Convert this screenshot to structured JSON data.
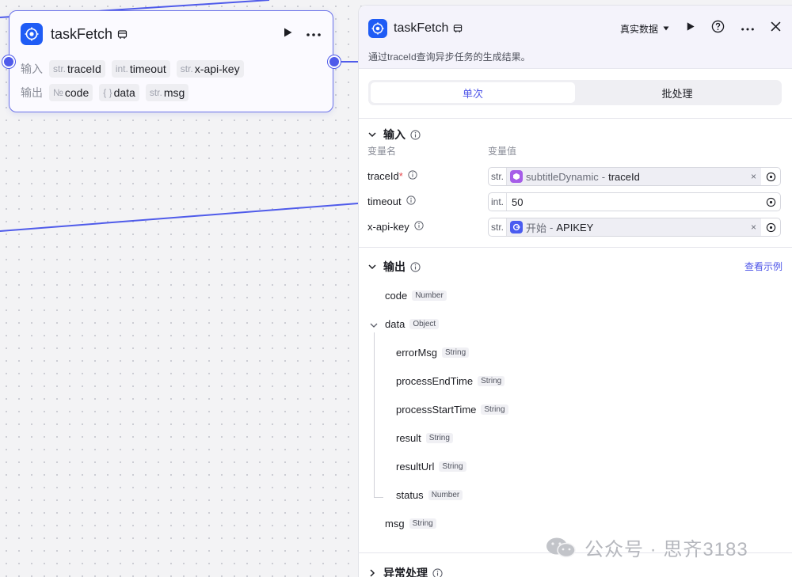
{
  "node": {
    "title": "taskFetch",
    "input_label": "输入",
    "output_label": "输出",
    "inputs": [
      {
        "type": "str.",
        "name": "traceId"
      },
      {
        "type": "int.",
        "name": "timeout"
      },
      {
        "type": "str.",
        "name": "x-api-key"
      }
    ],
    "outputs": [
      {
        "type": "№",
        "name": "code"
      },
      {
        "type": "{ }",
        "name": "data"
      },
      {
        "type": "str.",
        "name": "msg"
      }
    ]
  },
  "panel": {
    "title": "taskFetch",
    "data_mode": "真实数据",
    "description": "通过traceId查询异步任务的生成结果。",
    "tabs": [
      {
        "label": "单次",
        "active": true
      },
      {
        "label": "批处理",
        "active": false
      }
    ],
    "input_section": {
      "title": "输入",
      "col_name": "变量名",
      "col_value": "变量值",
      "rows": [
        {
          "name": "traceId",
          "required": "*",
          "type": "str.",
          "ref_node": "subtitleDynamic",
          "ref_sep": "-",
          "ref_var": "traceId"
        },
        {
          "name": "timeout",
          "type": "int.",
          "value": "50"
        },
        {
          "name": "x-api-key",
          "type": "str.",
          "ref_node": "开始",
          "ref_sep": "-",
          "ref_var": "APIKEY"
        }
      ]
    },
    "output_section": {
      "title": "输出",
      "example_link": "查看示例",
      "fields": [
        {
          "name": "code",
          "type": "Number"
        },
        {
          "name": "data",
          "type": "Object"
        },
        {
          "name": "errorMsg",
          "type": "String"
        },
        {
          "name": "processEndTime",
          "type": "String"
        },
        {
          "name": "processStartTime",
          "type": "String"
        },
        {
          "name": "result",
          "type": "String"
        },
        {
          "name": "resultUrl",
          "type": "String"
        },
        {
          "name": "status",
          "type": "Number"
        },
        {
          "name": "msg",
          "type": "String"
        }
      ]
    },
    "error_section": {
      "title": "异常处理"
    }
  },
  "watermark": "公众号 · 思齐3183",
  "colors": {
    "accent": "#4e55e8",
    "node_icon": "#1f5cf5",
    "port": "#4f5bea",
    "ref_purple": "#a65de8",
    "ref_blue": "#4a5cf0"
  }
}
